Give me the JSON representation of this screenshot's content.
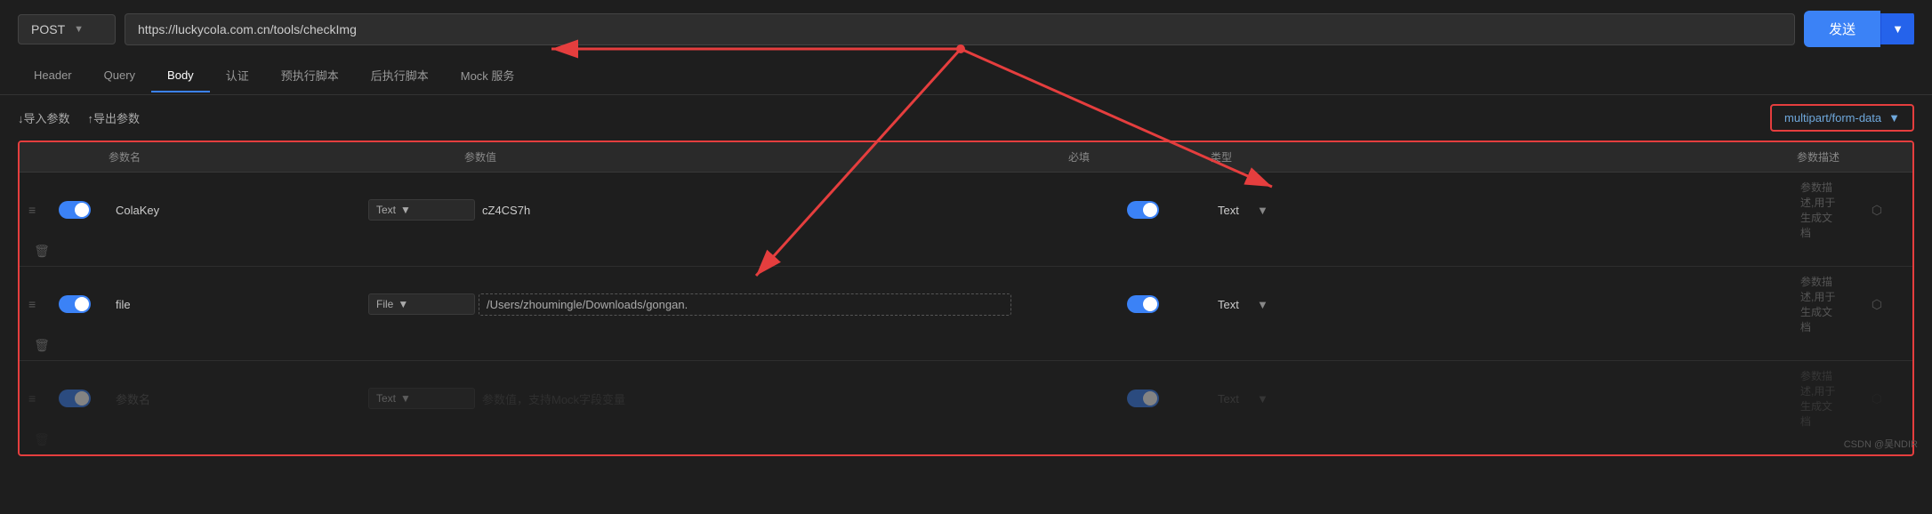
{
  "topbar": {
    "method": "POST",
    "method_chevron": "▼",
    "url": "https://luckycola.com.cn/tools/checkImg",
    "send_label": "发送",
    "send_chevron": "▼"
  },
  "tabs": [
    {
      "label": "Header",
      "active": false
    },
    {
      "label": "Query",
      "active": false
    },
    {
      "label": "Body",
      "active": true
    },
    {
      "label": "认证",
      "active": false
    },
    {
      "label": "预执行脚本",
      "active": false
    },
    {
      "label": "后执行脚本",
      "active": false
    },
    {
      "label": "Mock 服务",
      "active": false
    }
  ],
  "actions": {
    "import_label": "↓导入参数",
    "export_label": "↑导出参数",
    "content_type": "multipart/form-data",
    "content_type_chevron": "▼"
  },
  "table": {
    "headers": [
      "",
      "",
      "参数名",
      "",
      "参数值",
      "",
      "必填",
      "类型",
      "",
      "参数描述",
      "",
      ""
    ],
    "columns": {
      "param_name": "参数名",
      "param_value": "参数值",
      "required": "必填",
      "type": "类型",
      "desc": "参数描述"
    },
    "rows": [
      {
        "enabled": true,
        "name": "ColaKey",
        "name_type": "Text",
        "value": "cZ4CS7h",
        "required": true,
        "type": "Text",
        "desc": "参数描述,用于生成文档",
        "is_placeholder": false
      },
      {
        "enabled": true,
        "name": "file",
        "name_type": "File",
        "value": "/Users/zhoumingle/Downloads/gongan.",
        "required": true,
        "type": "Text",
        "desc": "参数描述,用于生成文档",
        "is_placeholder": false
      },
      {
        "enabled": true,
        "name": "参数名",
        "name_type": "Text",
        "value": "参数值，支持Mock字段变量",
        "required": true,
        "type": "Text",
        "desc": "参数描述,用于生成文档",
        "is_placeholder": true
      }
    ]
  },
  "watermark": "CSDN @吴NDIR"
}
